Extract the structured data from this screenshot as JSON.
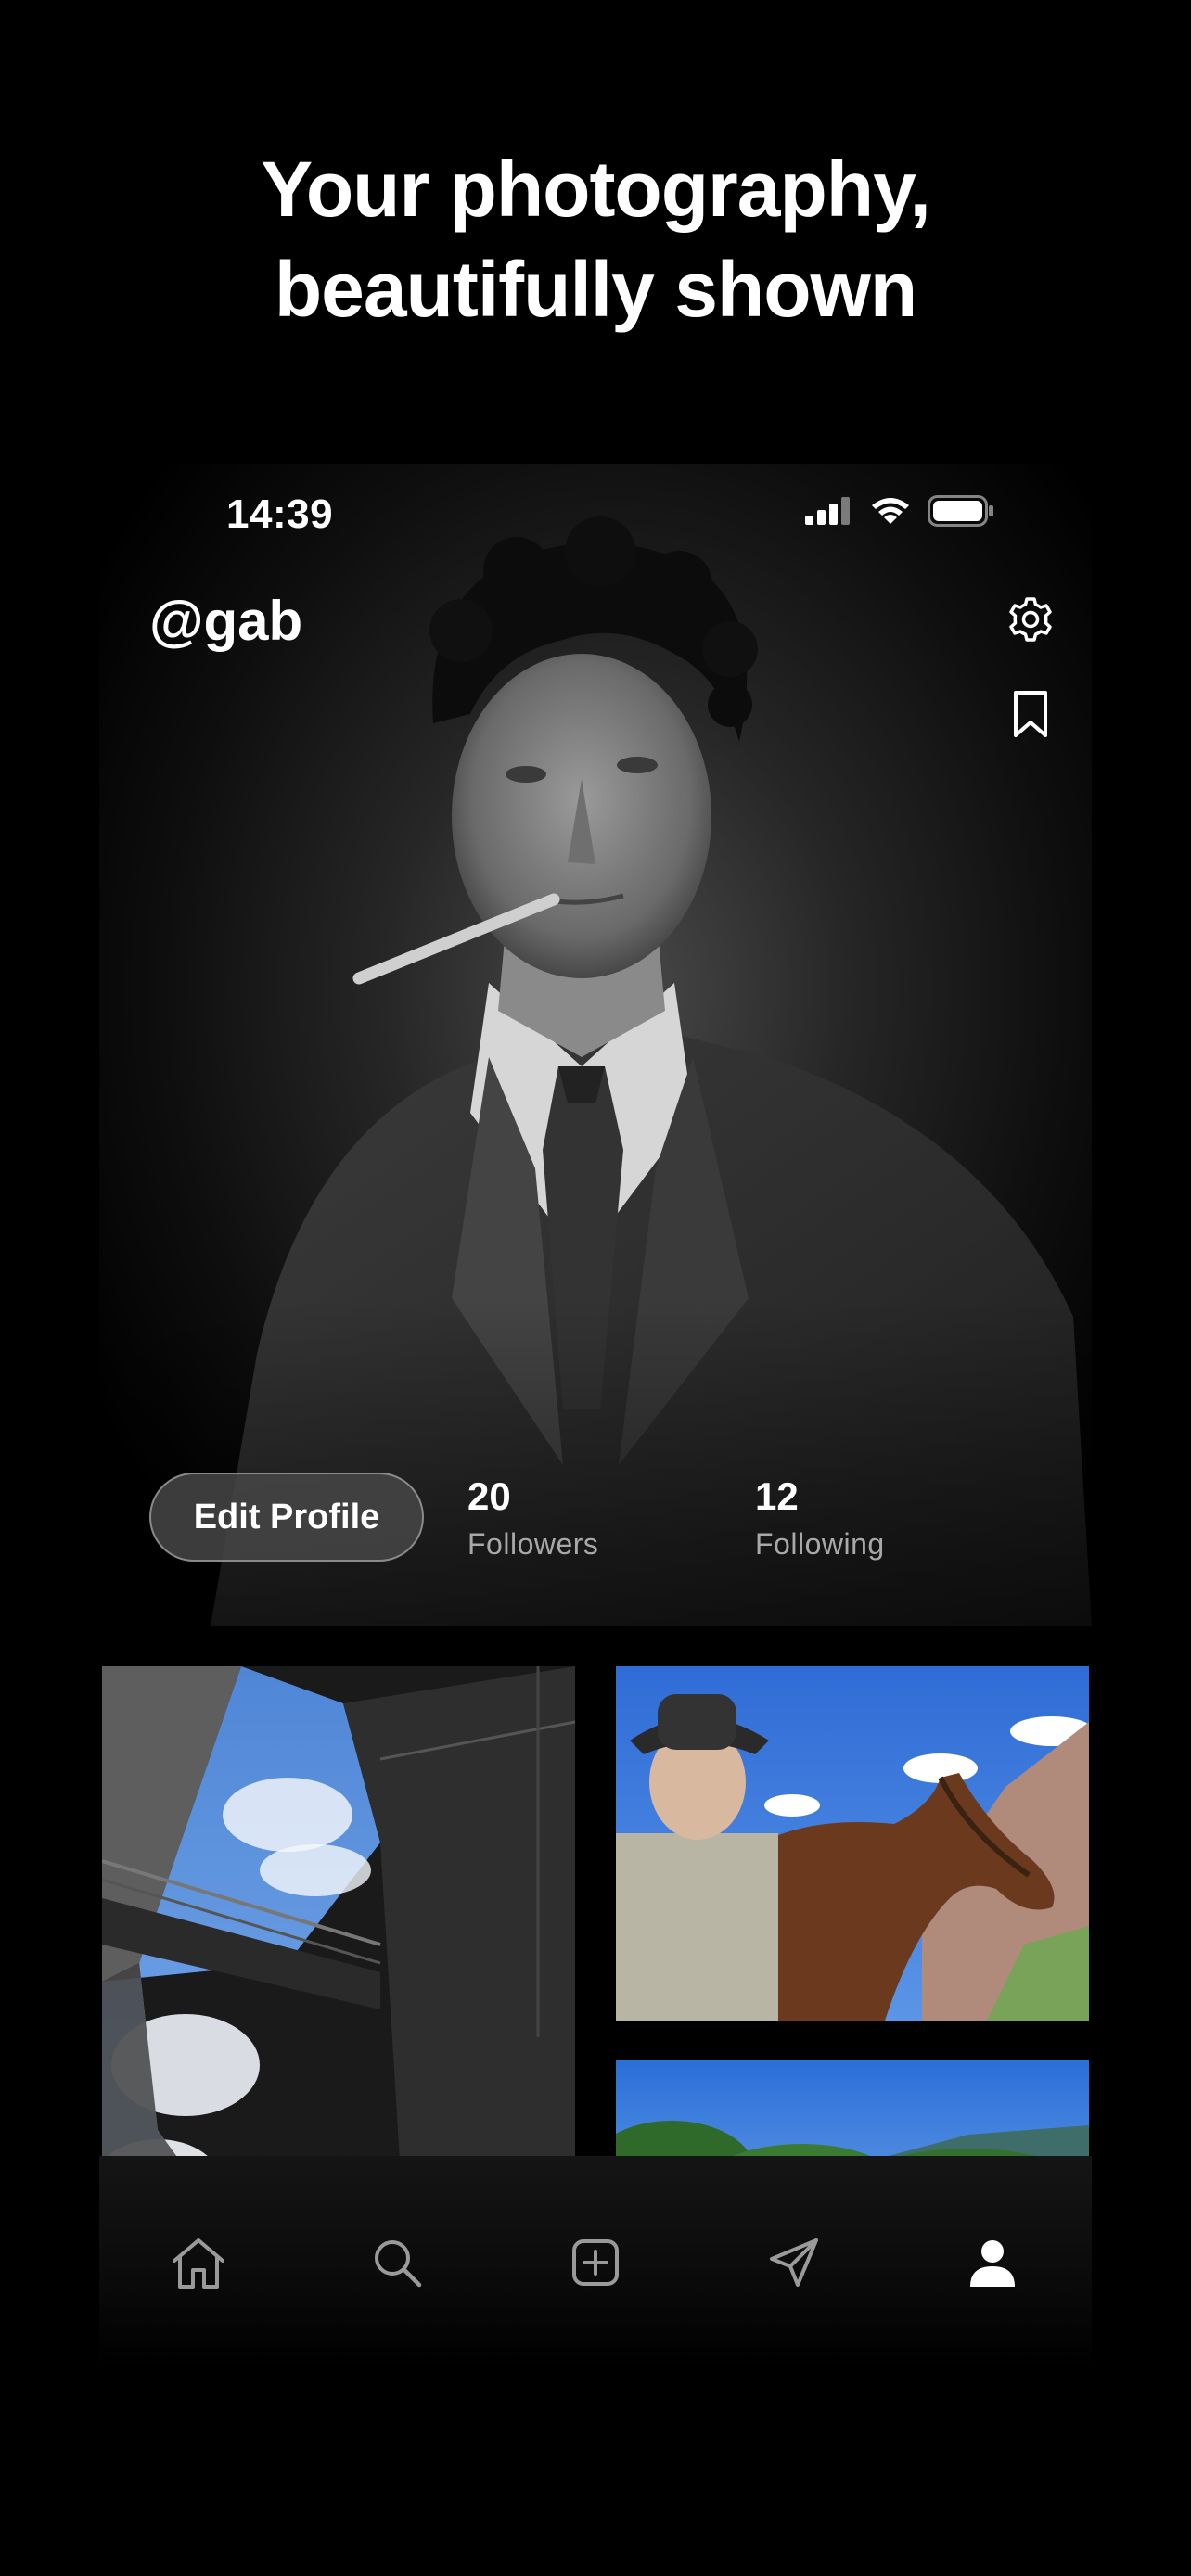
{
  "headline": {
    "line1": "Your photography,",
    "line2": "beautifully shown"
  },
  "status_bar": {
    "time": "14:39",
    "icons": [
      "cellular-signal-icon",
      "wifi-icon",
      "battery-icon"
    ]
  },
  "profile": {
    "username": "@gab",
    "edit_button_label": "Edit Profile",
    "followers_count": "20",
    "followers_label": "Followers",
    "following_count": "12",
    "following_label": "Following",
    "header_icons": [
      "gear-icon",
      "bookmark-icon"
    ]
  },
  "photos": [
    {
      "subject": "concrete-atrium-with-bridge-and-sky"
    },
    {
      "subject": "man-in-cowboy-hat-with-horse"
    },
    {
      "subject": "green-meadow-with-mountains"
    },
    {
      "subject": "sky-partial"
    }
  ],
  "tab_bar": {
    "items": [
      {
        "icon": "home-icon",
        "active": false
      },
      {
        "icon": "search-icon",
        "active": false
      },
      {
        "icon": "add-post-icon",
        "active": false
      },
      {
        "icon": "send-icon",
        "active": false
      },
      {
        "icon": "profile-icon",
        "active": true
      }
    ]
  },
  "colors": {
    "background": "#000000",
    "text": "#ffffff",
    "muted_text": "#a8a8a8",
    "inactive_tab": "#9a9a9a"
  }
}
